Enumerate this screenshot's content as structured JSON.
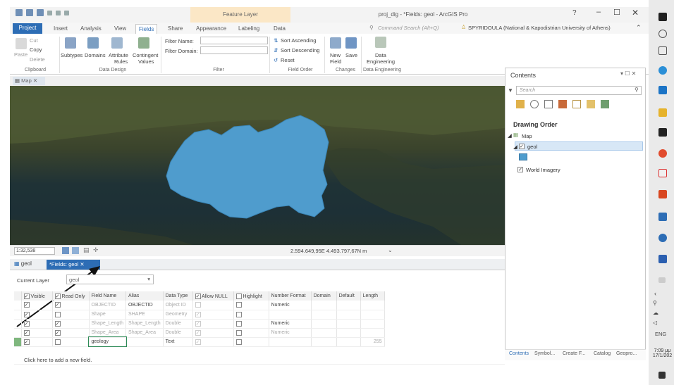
{
  "window": {
    "app_title": "proj_dig - *Fields: geol - ArcGIS Pro",
    "context_tab_label": "Feature Layer",
    "help": "?",
    "minimize": "–",
    "maximize": "☐",
    "close": "✕"
  },
  "tabs": {
    "project": "Project",
    "items": [
      "Insert",
      "Analysis",
      "View",
      "Fields",
      "Share",
      "Appearance",
      "Labeling",
      "Data"
    ],
    "active": "Fields"
  },
  "command_search": {
    "placeholder": "Command Search (Alt+Q)"
  },
  "user": {
    "name": "SPYRIDOULA (National & Kapodistrian University of Athens)"
  },
  "ribbon": {
    "clipboard": {
      "cut": "Cut",
      "copy": "Copy",
      "paste": "Paste",
      "delete": "Delete",
      "label": "Clipboard"
    },
    "data_design": {
      "subtypes": "Subtypes",
      "domains": "Domains",
      "attribute_rules_1": "Attribute",
      "attribute_rules_2": "Rules",
      "contingent_values_1": "Contingent",
      "contingent_values_2": "Values",
      "label": "Data Design"
    },
    "filter": {
      "name_label": "Filter Name:",
      "domain_label": "Filter Domain:",
      "label": "Filter"
    },
    "field_order": {
      "sort_ascending": "Sort Ascending",
      "sort_descending": "Sort Descending",
      "reset": "Reset",
      "label": "Field Order"
    },
    "changes": {
      "new_field_1": "New",
      "new_field_2": "Field",
      "save": "Save",
      "label": "Changes"
    },
    "data_engineering": {
      "btn_1": "Data",
      "btn_2": "Engineering",
      "label": "Data Engineering"
    }
  },
  "map_view": {
    "tab": "Map",
    "scale": "1:32,538",
    "coordinates": "2.594.649,95E 4.493.797,67N m"
  },
  "fields_view": {
    "tab_geol": "geol",
    "tab_fields": "*Fields: geol",
    "current_layer_label": "Current Layer",
    "current_layer_value": "geol",
    "columns": [
      "Visible",
      "Read Only",
      "Field Name",
      "Alias",
      "Data Type",
      "Allow NULL",
      "Highlight",
      "Number Format",
      "Domain",
      "Default",
      "Length"
    ],
    "rows": [
      {
        "visible": true,
        "read_only": true,
        "field_name": "OBJECTID",
        "alias": "OBJECTID",
        "data_type": "Object ID",
        "allow_null": false,
        "highlight": false,
        "number_format": "Numeric",
        "domain": "",
        "default": "",
        "length": ""
      },
      {
        "visible": true,
        "read_only": false,
        "field_name": "Shape",
        "alias": "SHAPE",
        "data_type": "Geometry",
        "allow_null": true,
        "highlight": false,
        "number_format": "",
        "domain": "",
        "default": "",
        "length": ""
      },
      {
        "visible": true,
        "read_only": true,
        "field_name": "Shape_Length",
        "alias": "Shape_Length",
        "data_type": "Double",
        "allow_null": true,
        "highlight": false,
        "number_format": "Numeric",
        "domain": "",
        "default": "",
        "length": ""
      },
      {
        "visible": true,
        "read_only": true,
        "field_name": "Shape_Area",
        "alias": "Shape_Area",
        "data_type": "Double",
        "allow_null": true,
        "highlight": false,
        "number_format": "Numeric",
        "domain": "",
        "default": "",
        "length": ""
      },
      {
        "visible": true,
        "read_only": false,
        "field_name": "geology",
        "alias": "",
        "data_type": "Text",
        "allow_null": true,
        "highlight": false,
        "number_format": "",
        "domain": "",
        "default": "",
        "length": "255"
      }
    ],
    "add_field": "Click here to add a new field."
  },
  "contents": {
    "title": "Contents",
    "controls": "▾ ☐ ✕",
    "search_placeholder": "Search",
    "drawing_order": "Drawing Order",
    "map": "Map",
    "layer_geol": "geol",
    "layer_world_imagery": "World Imagery",
    "footer_tabs": [
      "Contents",
      "Symbol...",
      "Create F...",
      "Catalog",
      "Geopro..."
    ]
  },
  "taskbar": {
    "lang": "ENG",
    "time": "7:09 μμ",
    "date": "17/1/202"
  },
  "colors": {
    "accent": "#2d6db5",
    "polygon_fill": "#4f9ccd",
    "context_tab": "#fbe7c6"
  }
}
